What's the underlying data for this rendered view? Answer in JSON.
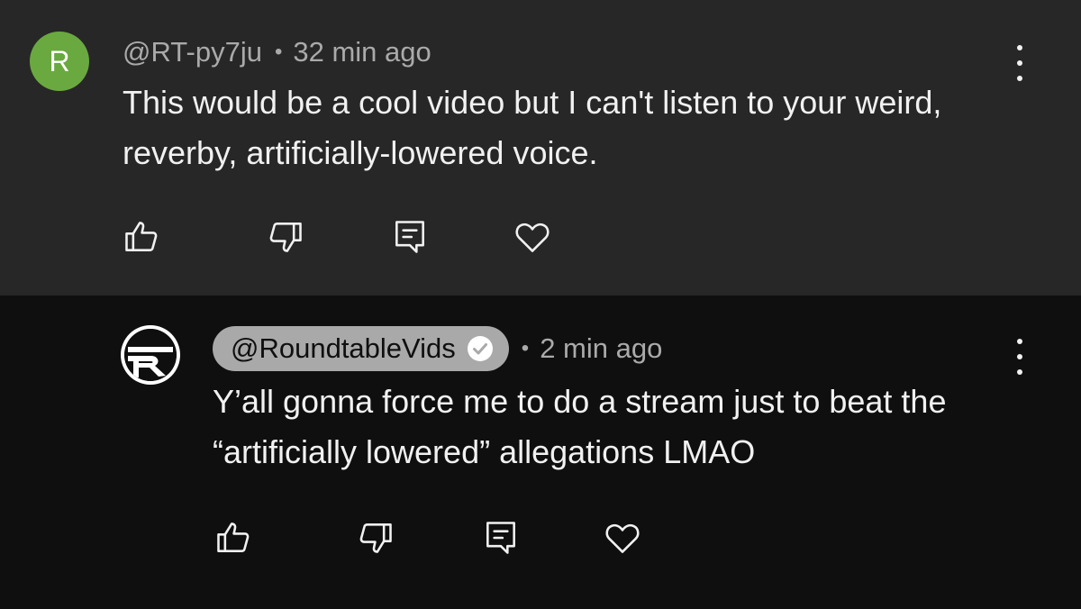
{
  "comments": [
    {
      "avatar_letter": "R",
      "avatar_color": "#6aa93f",
      "author": "@RT-py7ju",
      "separator": "•",
      "time": "32 min ago",
      "text": "This would be a cool video but I can't listen to your weird, reverby, artificially-lowered voice.",
      "is_owner": false
    },
    {
      "avatar_icon": "roundtable-logo-icon",
      "author": "@RoundtableVids",
      "verified_icon": "verified-check-icon",
      "separator": "•",
      "time": "2 min ago",
      "text": "Y’all gonna force me to do a stream just to beat the “artificially lowered” allegations LMAO",
      "is_owner": true
    }
  ],
  "actions": [
    "like-icon",
    "dislike-icon",
    "reply-icon",
    "heart-icon"
  ],
  "colors": {
    "surface_highlight": "#272727",
    "surface": "#0f0f0f",
    "owner_badge": "#a9a9a9",
    "meta_text": "#aaaaaa",
    "text": "#f1f1f1"
  }
}
